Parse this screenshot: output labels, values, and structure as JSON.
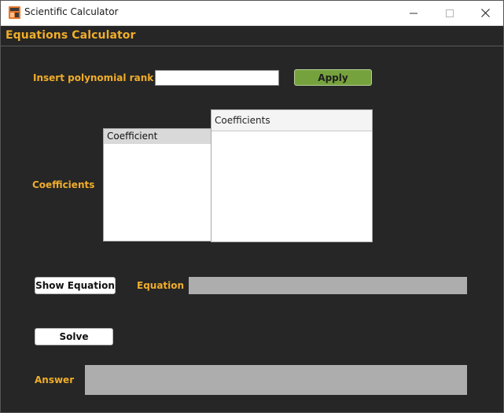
{
  "window": {
    "title": "Scientific Calculator",
    "controls": [
      "minimize-icon",
      "maximize-icon",
      "close-icon"
    ]
  },
  "header": {
    "title": "Equations Calculator"
  },
  "rank": {
    "label": "Insert polynomial rank",
    "value": "",
    "apply_label": "Apply"
  },
  "coefficients": {
    "label": "Coefficients",
    "list_header": "Coefficient",
    "table_header": "Coefficients"
  },
  "equation": {
    "button_label": "Show Equation",
    "label": "Equation",
    "value": ""
  },
  "solve": {
    "button_label": "Solve"
  },
  "answer": {
    "label": "Answer",
    "value": ""
  },
  "colors": {
    "background": "#262626",
    "accent_label": "#f0ad2a",
    "apply_button": "#76a23d",
    "readonly_field": "#adadad"
  }
}
